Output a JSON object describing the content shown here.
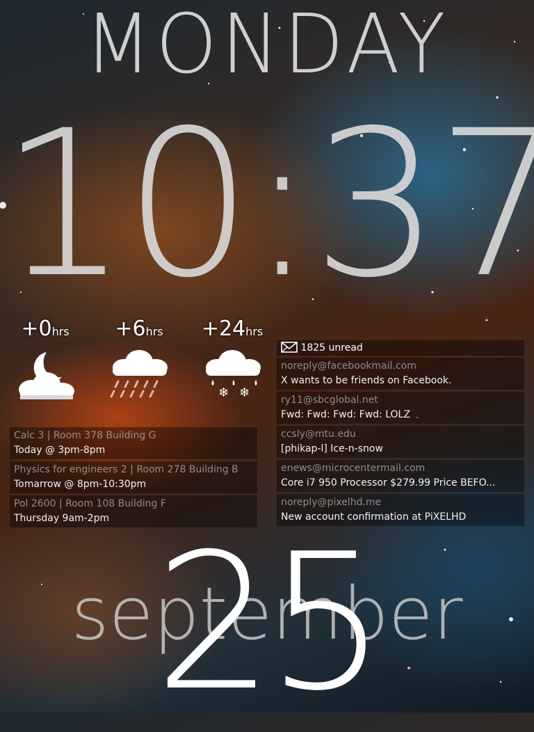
{
  "clock": {
    "day": "MONDAY",
    "time": "10:37",
    "month": "september",
    "date": "25"
  },
  "weather": [
    {
      "offset": "+0",
      "unit": "hrs",
      "icon": "moon-cloud-icon"
    },
    {
      "offset": "+6",
      "unit": "hrs",
      "icon": "rain-cloud-icon"
    },
    {
      "offset": "+24",
      "unit": "hrs",
      "icon": "snow-cloud-icon"
    }
  ],
  "calendar": [
    {
      "title": "Calc 3 | Room 378 Building G",
      "when": "Today @ 3pm-8pm"
    },
    {
      "title": "Physics for engineers 2 | Room 278 Building B",
      "when": "Tomarrow @ 8pm-10:30pm"
    },
    {
      "title": "Pol 2600 | Room 108 Building F",
      "when": "Thursday 9am-2pm"
    }
  ],
  "mail": {
    "unread": "1825 unread",
    "items": [
      {
        "from": "noreply@facebookmail.com",
        "subject": "X wants to be friends on Facebook."
      },
      {
        "from": "ry11@sbcglobal.net",
        "subject": "Fwd: Fwd: Fwd: Fwd: LOLZ"
      },
      {
        "from": "ccsly@mtu.edu",
        "subject": "[phikap-l] Ice-n-snow"
      },
      {
        "from": "enews@microcentermail.com",
        "subject": "Core i7 950 Processor $279.99 Price BEFO..."
      },
      {
        "from": "noreply@pixelhd.me",
        "subject": "New account confirmation at PiXELHD"
      }
    ]
  }
}
